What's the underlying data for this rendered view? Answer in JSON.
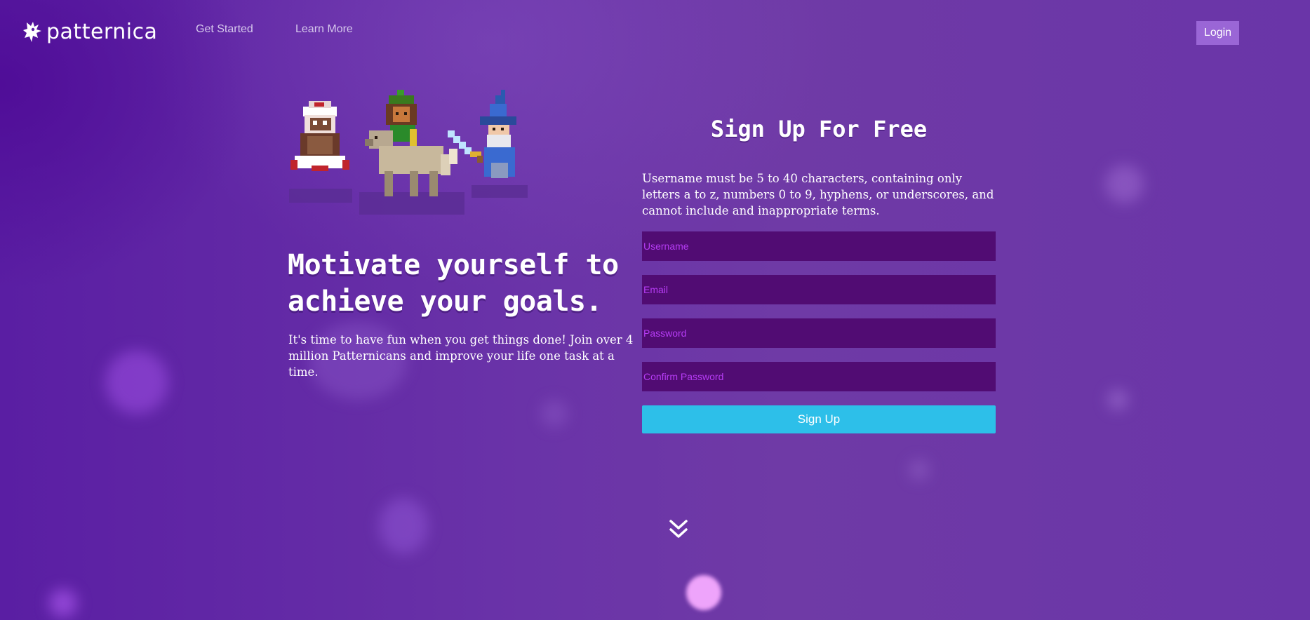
{
  "header": {
    "brand": "patternica",
    "nav": [
      {
        "label": "Get Started"
      },
      {
        "label": "Learn More"
      }
    ],
    "login_label": "Login"
  },
  "hero": {
    "title": "Motivate yourself to achieve your goals.",
    "subtitle": "It's time to have fun when you get things done! Join over 4 million Patternicans and improve your life one task at a time."
  },
  "signup": {
    "title": "Sign Up For Free",
    "hint": "Username must be 5 to 40 characters, containing only letters a to z, numbers 0 to 9, hyphens, or underscores, and cannot include and inappropriate terms.",
    "fields": {
      "username": {
        "placeholder": "Username",
        "value": ""
      },
      "email": {
        "placeholder": "Email",
        "value": ""
      },
      "password": {
        "placeholder": "Password",
        "value": ""
      },
      "confirm_password": {
        "placeholder": "Confirm Password",
        "value": ""
      }
    },
    "button_label": "Sign Up"
  },
  "icons": {
    "logo": "gryphon-logo-icon",
    "scroll": "double-chevron-down-icon"
  },
  "colors": {
    "background": "#6a33a8",
    "input_background": "#510c73",
    "placeholder": "#b63cf4",
    "signup_button": "#2dbfe9",
    "login_button": "#9a66d6"
  }
}
